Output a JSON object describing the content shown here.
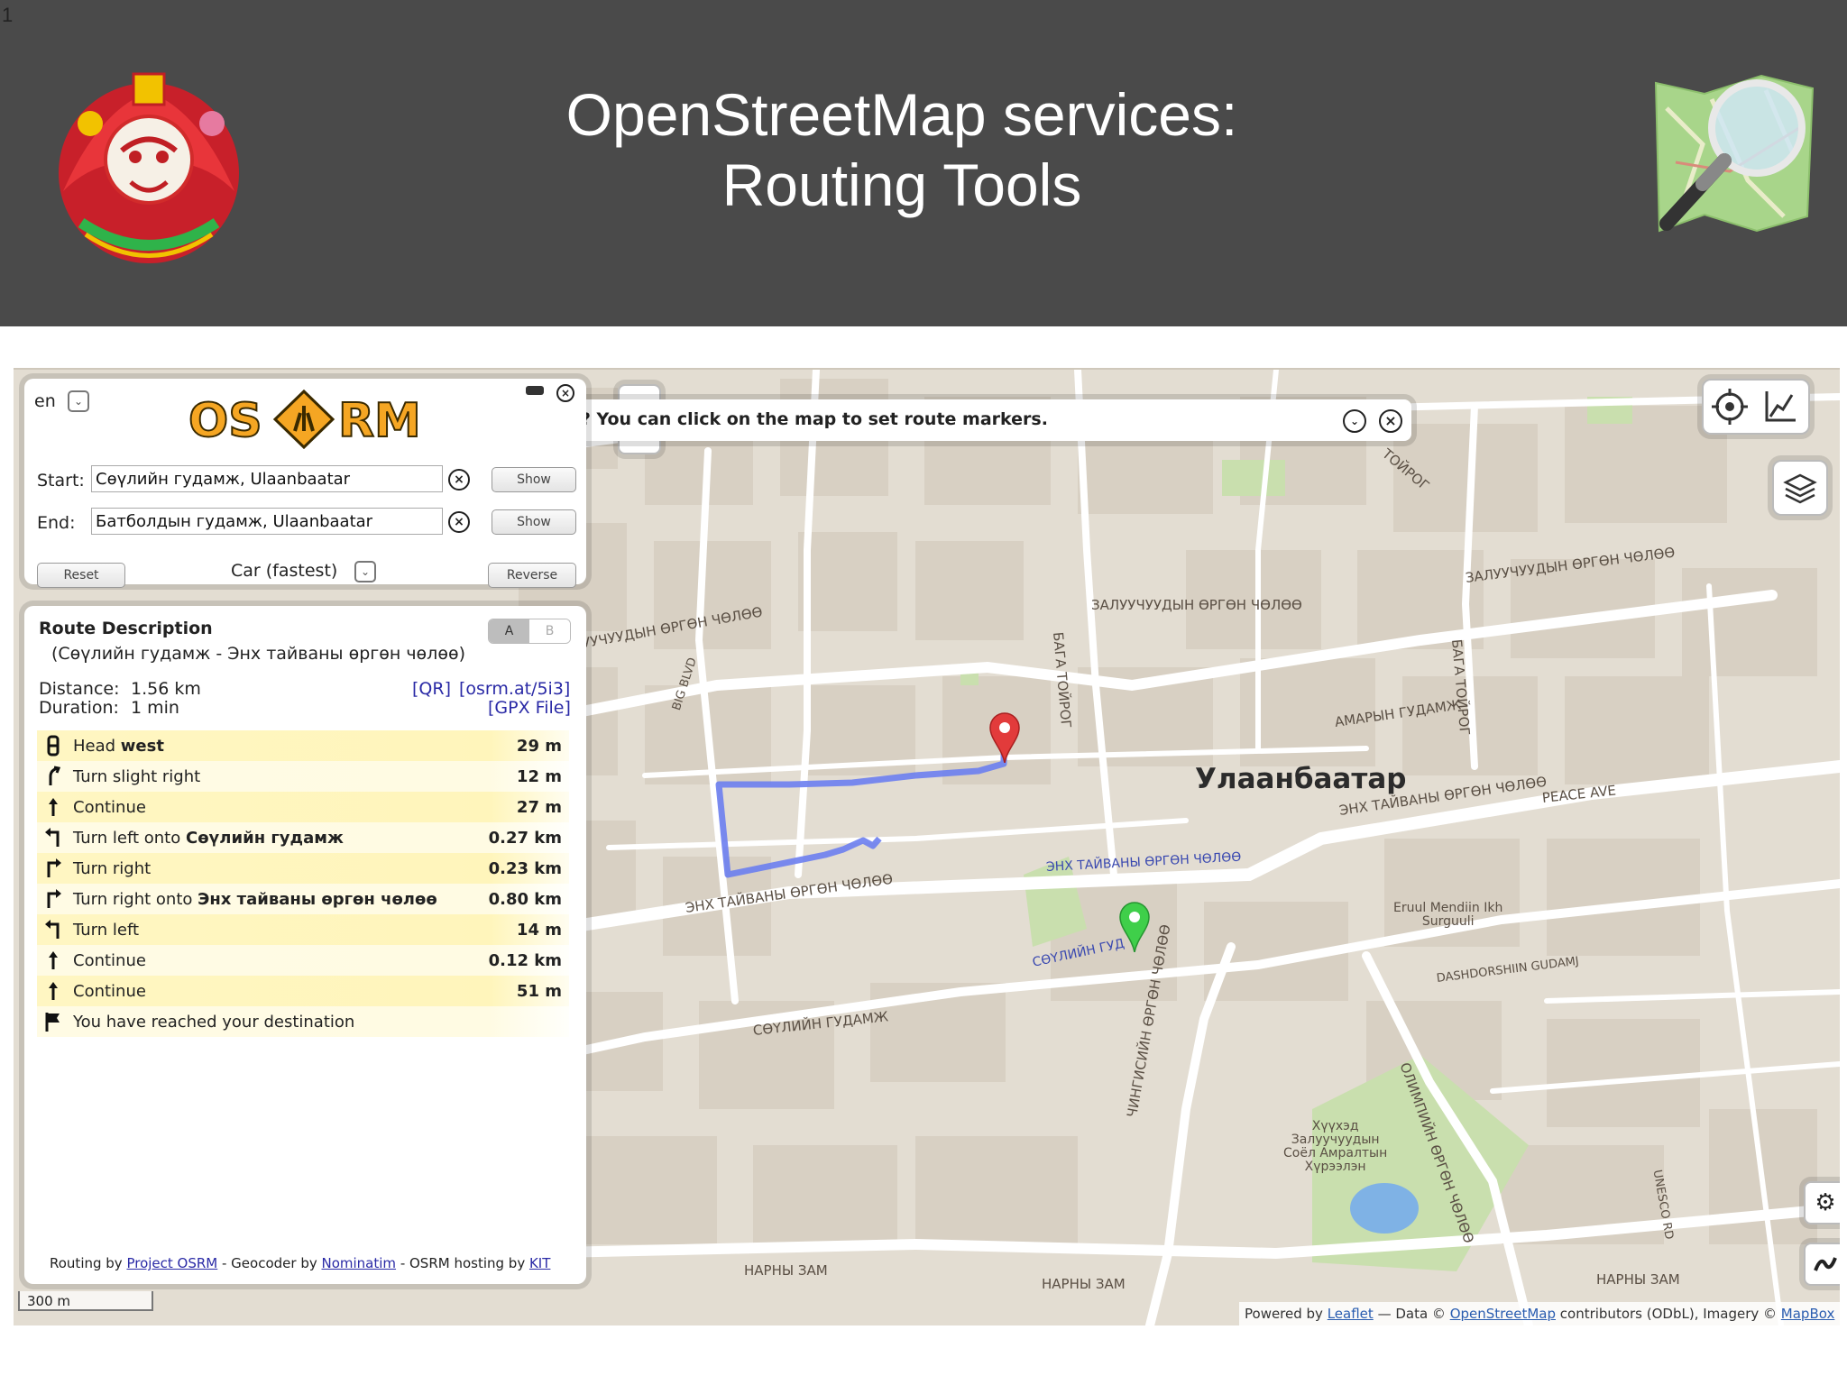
{
  "slide": {
    "number": "1",
    "title_line1": "OpenStreetMap services:",
    "title_line2": "Routing Tools"
  },
  "colors": {
    "header_bg": "#4a4a4a",
    "map_bg": "#e3ddd2",
    "route": "#6c7ef0",
    "start_marker": "#3fcf4a",
    "end_marker": "#e23b3b",
    "step_highlight": "#fff6c2"
  },
  "osrm": {
    "language": "en",
    "logo_text": [
      "OS",
      "RM"
    ],
    "start_label": "Start:",
    "start_value": "Сөүлийн гудамж, Ulaanbaatar",
    "end_label": "End:",
    "end_value": "Батболдын гудамж, Ulaanbaatar",
    "show_label": "Show",
    "reset_label": "Reset",
    "profile": "Car (fastest)",
    "reverse_label": "Reverse"
  },
  "tip": {
    "text": "Did you know? You can click on the map to set route markers."
  },
  "route": {
    "title": "Route Description",
    "subtitle": "(Сөүлийн гудамж - Энх тайваны өргөн чөлөө)",
    "distance_label": "Distance:",
    "distance": "1.56 km",
    "duration_label": "Duration:",
    "duration": "1 min",
    "qr": "[QR]",
    "short_link": "[osrm.at/5i3]",
    "gpx": "[GPX File]",
    "alt_a": "A",
    "alt_b": "B",
    "steps": [
      {
        "icon": "head-icon",
        "prefix": "Head ",
        "bold": "west",
        "distance": "29 m"
      },
      {
        "icon": "turn-slight-right-icon",
        "prefix": "Turn slight right",
        "bold": "",
        "distance": "12 m"
      },
      {
        "icon": "continue-icon",
        "prefix": "Continue",
        "bold": "",
        "distance": "27 m"
      },
      {
        "icon": "turn-left-icon",
        "prefix": "Turn left onto ",
        "bold": "Сөүлийн гудамж",
        "distance": "0.27 km"
      },
      {
        "icon": "turn-right-icon",
        "prefix": "Turn right",
        "bold": "",
        "distance": "0.23 km"
      },
      {
        "icon": "turn-right-icon",
        "prefix": "Turn right onto ",
        "bold": "Энх тайваны өргөн чөлөө",
        "distance": "0.80 km"
      },
      {
        "icon": "turn-left-icon",
        "prefix": "Turn left",
        "bold": "",
        "distance": "14 m"
      },
      {
        "icon": "continue-icon",
        "prefix": "Continue",
        "bold": "",
        "distance": "0.12 km"
      },
      {
        "icon": "continue-icon",
        "prefix": "Continue",
        "bold": "",
        "distance": "51 m"
      },
      {
        "icon": "destination-flag-icon",
        "prefix": "You have reached your destination",
        "bold": "",
        "distance": ""
      }
    ],
    "credit": {
      "routing_by": "Routing by ",
      "project": "Project OSRM",
      "geocoder_by": " - Geocoder by ",
      "nominatim": "Nominatim",
      "hosting_by": " - OSRM hosting by ",
      "kit": "KIT"
    }
  },
  "map": {
    "city": "Улаанбаатар",
    "zoom_out": "−",
    "scale": "300 m",
    "labels": {
      "zaluuchuud1": "ЗАЛУУЧУУДЫН ӨРГӨН ЧӨЛӨӨ",
      "zaluuchuud2": "ЗАЛУУЧУУДЫН ӨРГӨН ЧӨЛӨӨ",
      "zaluuchuud3": "ЗАЛУУЧУУДЫН ӨРГӨН ЧӨЛӨӨ",
      "enkh1": "ЭНХ ТАЙВАНЫ ӨРГӨН ЧӨЛӨӨ",
      "enkh2": "ЭНХ ТАЙВАНЫ ӨРГӨН ЧӨЛӨӨ",
      "enkh3": "ЭНХ ТАЙВАНЫ ӨРГӨН ЧӨЛӨӨ",
      "peace": "PEACE AVE",
      "soul1": "СӨҮЛИЙН ГУДАМЖ",
      "soul2": "СӨҮЛИЙН ГУД",
      "amar": "АМАРЫН ГУДАМЖ",
      "baga1": "БАГА ТОЙРОГ",
      "baga2": "БАГА ТОЙРОГ",
      "toirog": "ТОЙРОГ",
      "big_blvd": "BIG BLVD",
      "dashdorj": "DASHDORSHIIN GUDAMJ",
      "olimp": "ОЛИМПИЙН ӨРГӨН ЧӨЛӨӨ",
      "chinggis": "ЧИНГИСИЙН ӨРГӨН ЧӨЛӨӨ",
      "harnyzam1": "НАРНЫ ЗАМ",
      "harnyzam2": "НАРНЫ ЗАМ",
      "harnyzam3": "НАРНЫ ЗАМ",
      "unesco": "UNESCO RD",
      "eruul": "Eruul Mendiin Ikh\nSurguuli",
      "khuukhed": "Хүүхэд\nЗалуучуудын\nСоёл Амралтын\nХүрээлэн"
    }
  },
  "attribution": {
    "powered_by": "Powered by ",
    "leaflet": "Leaflet",
    "data": " — Data © ",
    "osm": "OpenStreetMap",
    "contributors": " contributors (ODbL), Imagery © ",
    "mapbox": "MapBox"
  }
}
